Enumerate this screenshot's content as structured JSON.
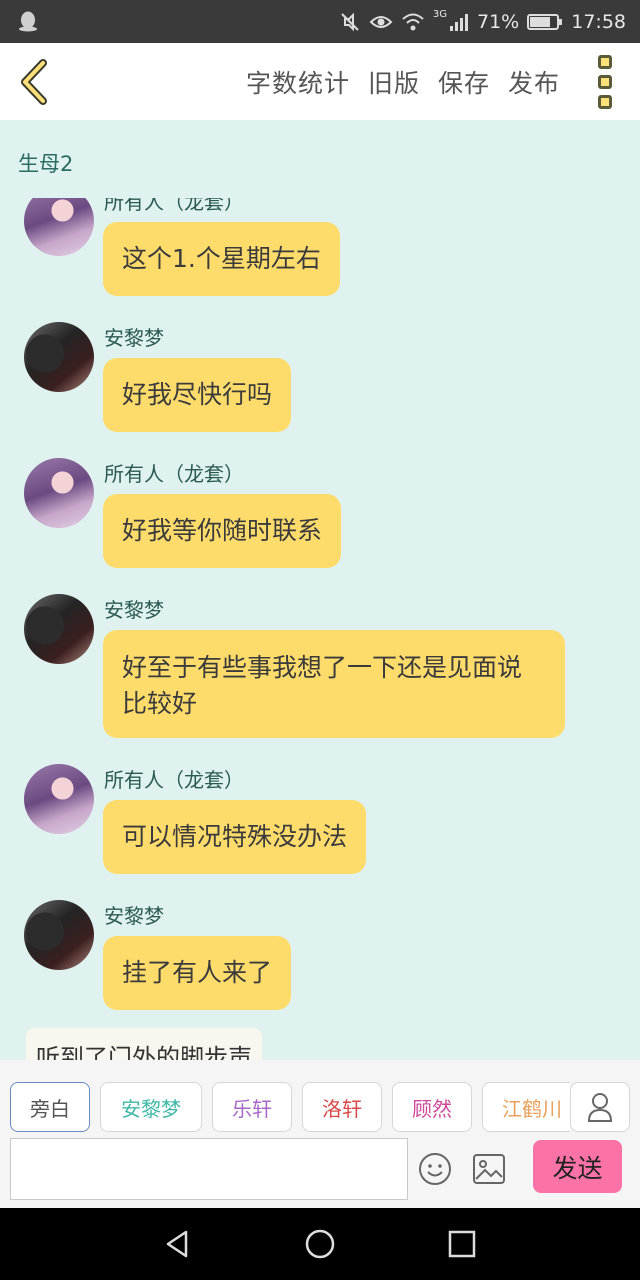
{
  "status_bar": {
    "battery": "71%",
    "time": "17:58",
    "network": "3G"
  },
  "nav": {
    "actions": [
      "字数统计",
      "旧版",
      "保存",
      "发布"
    ]
  },
  "chat": {
    "title": "生母2",
    "messages": [
      {
        "sender": "所有人（龙套）",
        "text": "这个1.个星期左右",
        "avatar": "purple"
      },
      {
        "sender": "安黎梦",
        "text": "好我尽快行吗",
        "avatar": "dark"
      },
      {
        "sender": "所有人（龙套）",
        "text": "好我等你随时联系",
        "avatar": "purple"
      },
      {
        "sender": "安黎梦",
        "text": "好至于有些事我想了一下还是见面说比较好",
        "avatar": "dark"
      },
      {
        "sender": "所有人（龙套）",
        "text": "可以情况特殊没办法",
        "avatar": "purple"
      },
      {
        "sender": "安黎梦",
        "text": "挂了有人来了",
        "avatar": "dark"
      }
    ],
    "narration": "听到了门外的脚步声"
  },
  "composer": {
    "roles": [
      {
        "label": "旁白",
        "color": "#555555"
      },
      {
        "label": "安黎梦",
        "color": "#3fb8a8"
      },
      {
        "label": "乐轩",
        "color": "#a868c8"
      },
      {
        "label": "洛轩",
        "color": "#d84a4a"
      },
      {
        "label": "顾然",
        "color": "#d04a9a"
      },
      {
        "label": "江鹤川",
        "color": "#e8a05a"
      }
    ],
    "input_value": "",
    "send_label": "发送"
  },
  "colors": {
    "bubble": "#fedc6c",
    "chat_bg": "#dff2f0",
    "send": "#fb73a6"
  }
}
